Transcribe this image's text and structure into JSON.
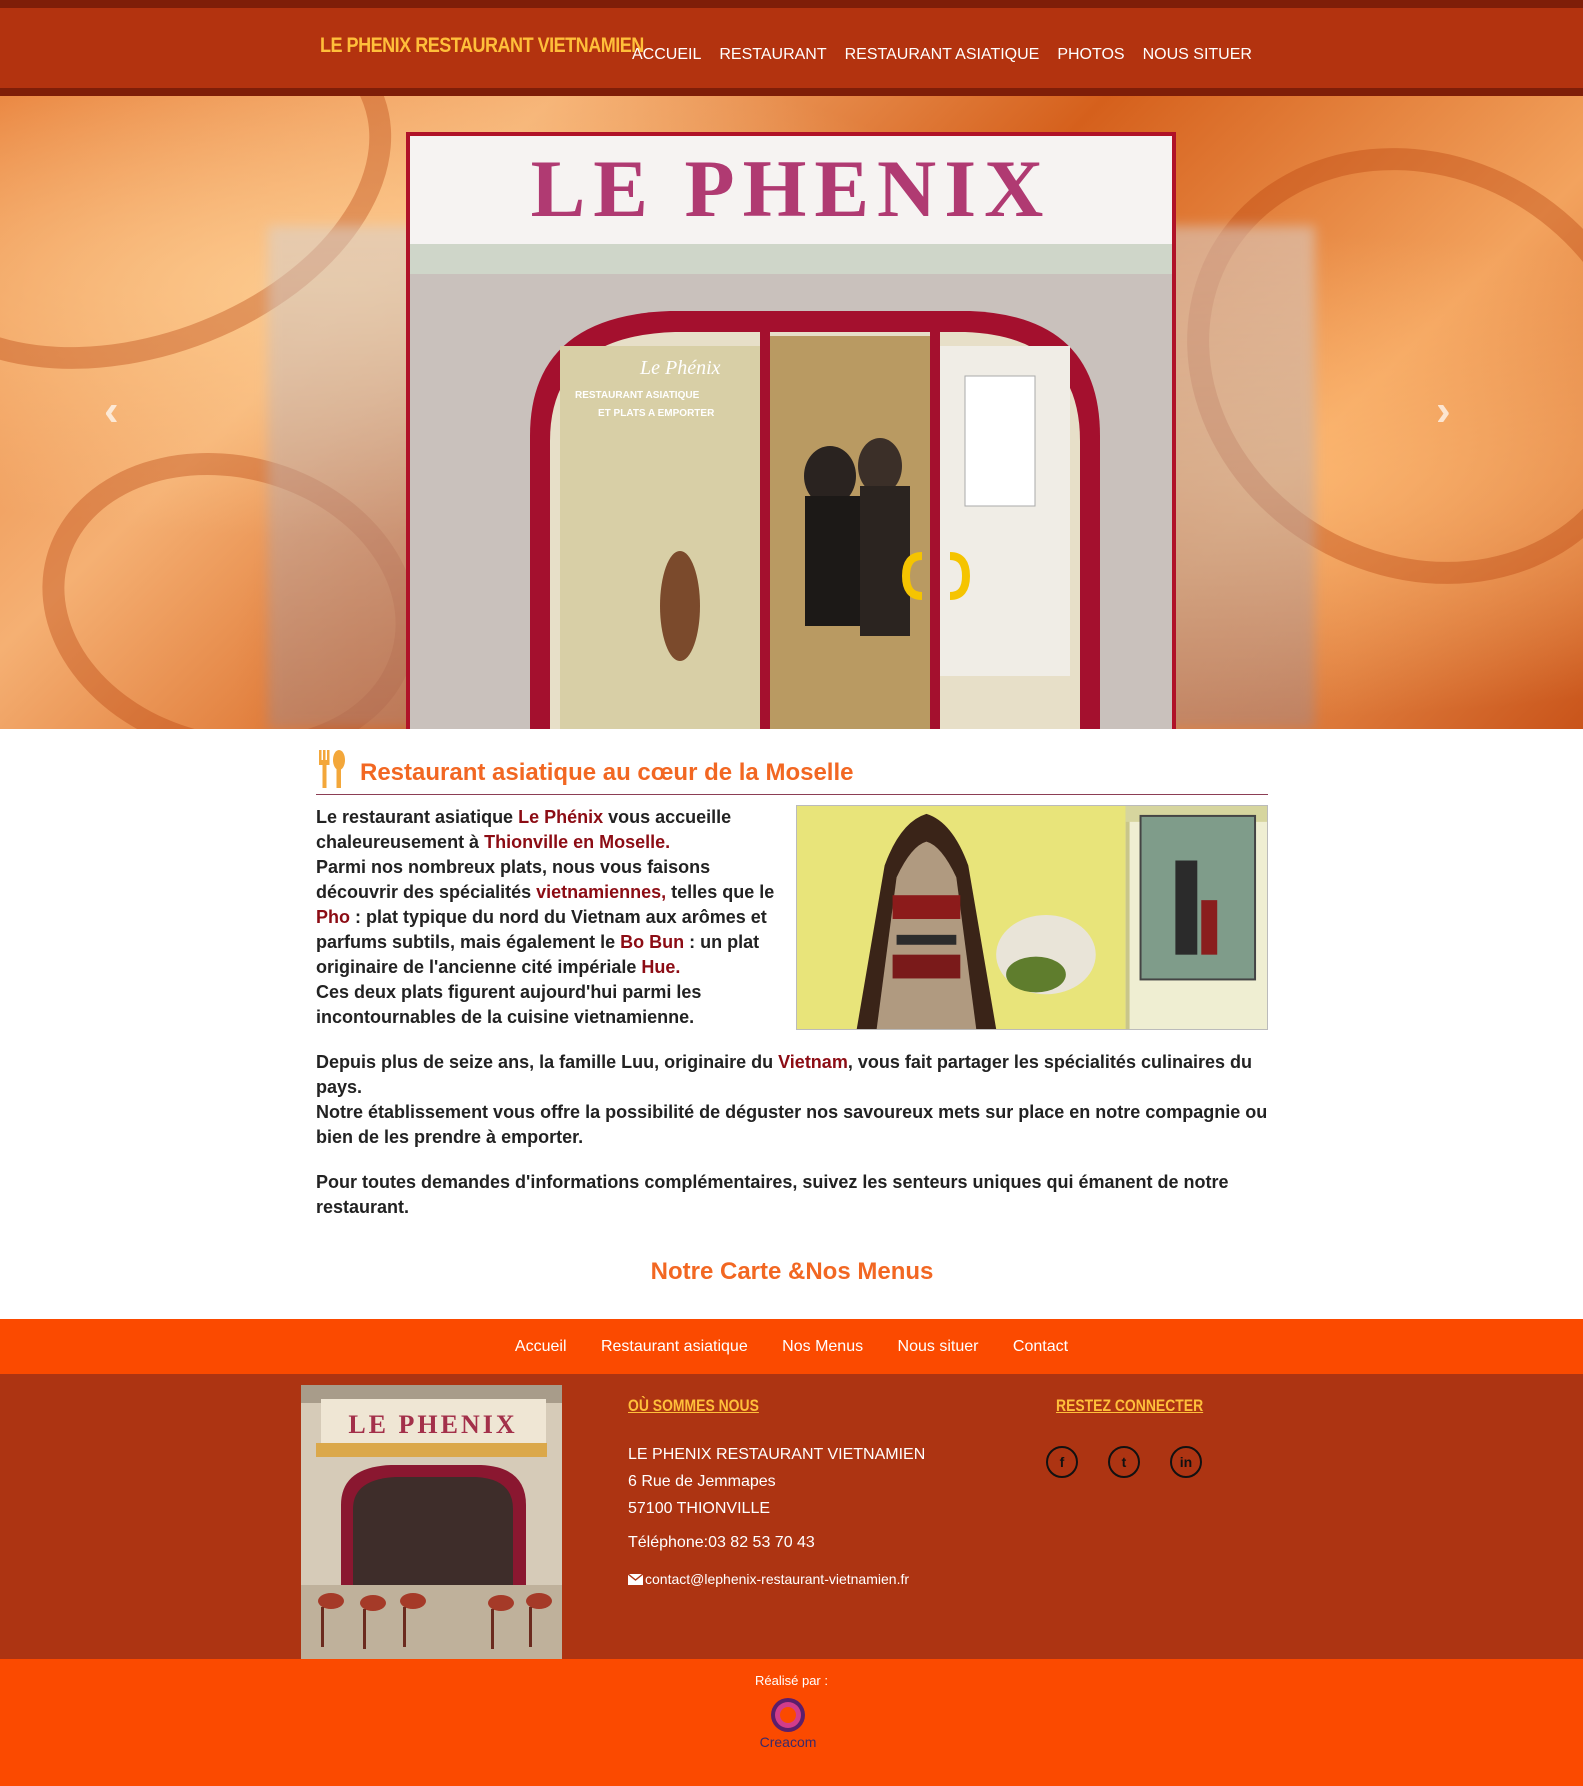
{
  "header": {
    "brand": "LE PHENIX RESTAURANT VIETNAMIEN",
    "nav": [
      "ACCUEIL",
      "RESTAURANT",
      "RESTAURANT ASIATIQUE",
      "PHOTOS",
      "NOUS SITUER"
    ]
  },
  "hero": {
    "sign_text": "LE PHENIX",
    "window_text_1": "Le Phénix",
    "window_text_2": "RESTAURANT ASIATIQUE",
    "window_text_3": "ET PLATS A EMPORTER",
    "prev_icon": "chevron-left-icon",
    "next_icon": "chevron-right-icon"
  },
  "main": {
    "title": "Restaurant asiatique au cœur de la Moselle",
    "p1": {
      "a": "Le restaurant asiatique ",
      "b": "Le Phénix",
      "c": " vous accueille chaleureusement à ",
      "d": "Thionville en Moselle.",
      "e": "Parmi nos nombreux plats, nous vous faisons découvrir des spécialités ",
      "f": "vietnamiennes,",
      "g": " telles que le ",
      "h": "Pho",
      "i": " : plat typique du nord du Vietnam aux arômes et parfums subtils, mais également le ",
      "j": "Bo Bun",
      "k": " : un plat originaire de l'ancienne cité impériale ",
      "l": "Hue.",
      "m": "Ces deux plats figurent aujourd'hui parmi les incontournables de la cuisine vietnamienne."
    },
    "p2": {
      "a": "Depuis plus de seize ans, la famille Luu, originaire du ",
      "b": "Vietnam",
      "c": ", vous fait partager les spécialités culinaires du pays.",
      "d": "Notre établissement vous offre la possibilité de déguster nos savoureux mets sur place en notre compagnie ou bien de les prendre à emporter."
    },
    "p3": "Pour toutes demandes d'informations complémentaires, suivez les senteurs uniques qui émanent de notre restaurant.",
    "carte_link": "Notre Carte &Nos Menus"
  },
  "footer_nav": [
    "Accueil",
    "Restaurant asiatique",
    "Nos Menus",
    "Nous situer",
    "Contact"
  ],
  "footer": {
    "img_sign": "LE PHENIX",
    "where_title": "OÙ SOMMES NOUS",
    "name": "LE PHENIX RESTAURANT VIETNAMIEN",
    "street": "6 Rue de Jemmapes",
    "city": "57100 THIONVILLE",
    "phone": "Téléphone:03 82 53 70 43",
    "email": "contact@lephenix-restaurant-vietnamien.fr",
    "social_title": "RESTEZ CONNECTER",
    "social": [
      "f",
      "t",
      "in"
    ]
  },
  "credits": {
    "label": "Réalisé par :",
    "logo_text": "Creacom"
  },
  "colors": {
    "topbar": "#b3330f",
    "brand": "#ffbf3a",
    "accent": "#f26722",
    "highlight": "#8c0c14",
    "footnav": "#fb4a00",
    "footer": "#ad3412"
  }
}
